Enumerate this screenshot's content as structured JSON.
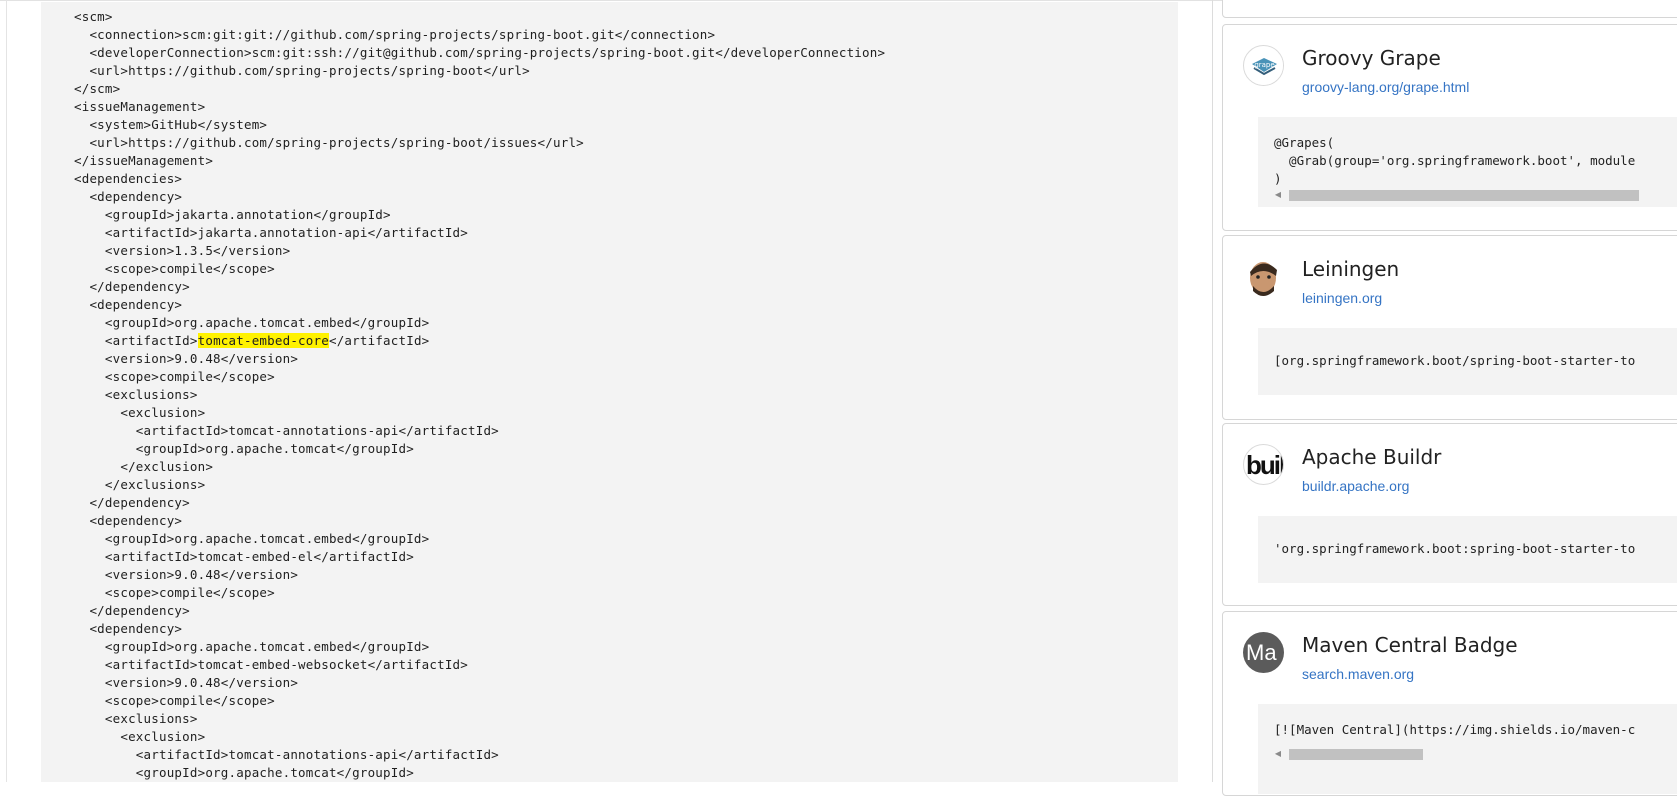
{
  "pom": {
    "lines": [
      "<scm>",
      "  <connection>scm:git:git://github.com/spring-projects/spring-boot.git</connection>",
      "  <developerConnection>scm:git:ssh://git@github.com/spring-projects/spring-boot.git</developerConnection>",
      "  <url>https://github.com/spring-projects/spring-boot</url>",
      "</scm>",
      "<issueManagement>",
      "  <system>GitHub</system>",
      "  <url>https://github.com/spring-projects/spring-boot/issues</url>",
      "</issueManagement>",
      "<dependencies>",
      "  <dependency>",
      "    <groupId>jakarta.annotation</groupId>",
      "    <artifactId>jakarta.annotation-api</artifactId>",
      "    <version>1.3.5</version>",
      "    <scope>compile</scope>",
      "  </dependency>",
      "  <dependency>",
      "    <groupId>org.apache.tomcat.embed</groupId>",
      "    <artifactId>tomcat-embed-core</artifactId>",
      "    <version>9.0.48</version>",
      "    <scope>compile</scope>",
      "    <exclusions>",
      "      <exclusion>",
      "        <artifactId>tomcat-annotations-api</artifactId>",
      "        <groupId>org.apache.tomcat</groupId>",
      "      </exclusion>",
      "    </exclusions>",
      "  </dependency>",
      "  <dependency>",
      "    <groupId>org.apache.tomcat.embed</groupId>",
      "    <artifactId>tomcat-embed-el</artifactId>",
      "    <version>9.0.48</version>",
      "    <scope>compile</scope>",
      "  </dependency>",
      "  <dependency>",
      "    <groupId>org.apache.tomcat.embed</groupId>",
      "    <artifactId>tomcat-embed-websocket</artifactId>",
      "    <version>9.0.48</version>",
      "    <scope>compile</scope>",
      "    <exclusions>",
      "      <exclusion>",
      "        <artifactId>tomcat-annotations-api</artifactId>",
      "        <groupId>org.apache.tomcat</groupId>"
    ],
    "highlight": {
      "before": "    <artifactId>",
      "match": "tomcat-embed-core",
      "after": "</artifactId>"
    }
  },
  "cards": [
    {
      "title": "Groovy Grape",
      "link": "groovy-lang.org/grape.html",
      "icon": "groovy-grape-logo",
      "snippet": [
        "@Grapes(",
        "  @Grab(group='org.springframework.boot', module",
        ")"
      ]
    },
    {
      "title": "Leiningen",
      "link": "leiningen.org",
      "icon": "leiningen-avatar",
      "snippet": [
        "[org.springframework.boot/spring-boot-starter-to"
      ]
    },
    {
      "title": "Apache Buildr",
      "link": "buildr.apache.org",
      "icon": "buildr-logo",
      "icon_text": "buil",
      "snippet": [
        "'org.springframework.boot:spring-boot-starter-to"
      ]
    },
    {
      "title": "Maven Central Badge",
      "link": "search.maven.org",
      "icon": "maven-central-avatar",
      "icon_text": "Ma",
      "snippet": [
        "[![Maven Central](https://img.shields.io/maven-c"
      ]
    }
  ],
  "colors": {
    "highlight": "#fff200",
    "link": "#3574c4",
    "code_bg": "#f3f3f3"
  }
}
